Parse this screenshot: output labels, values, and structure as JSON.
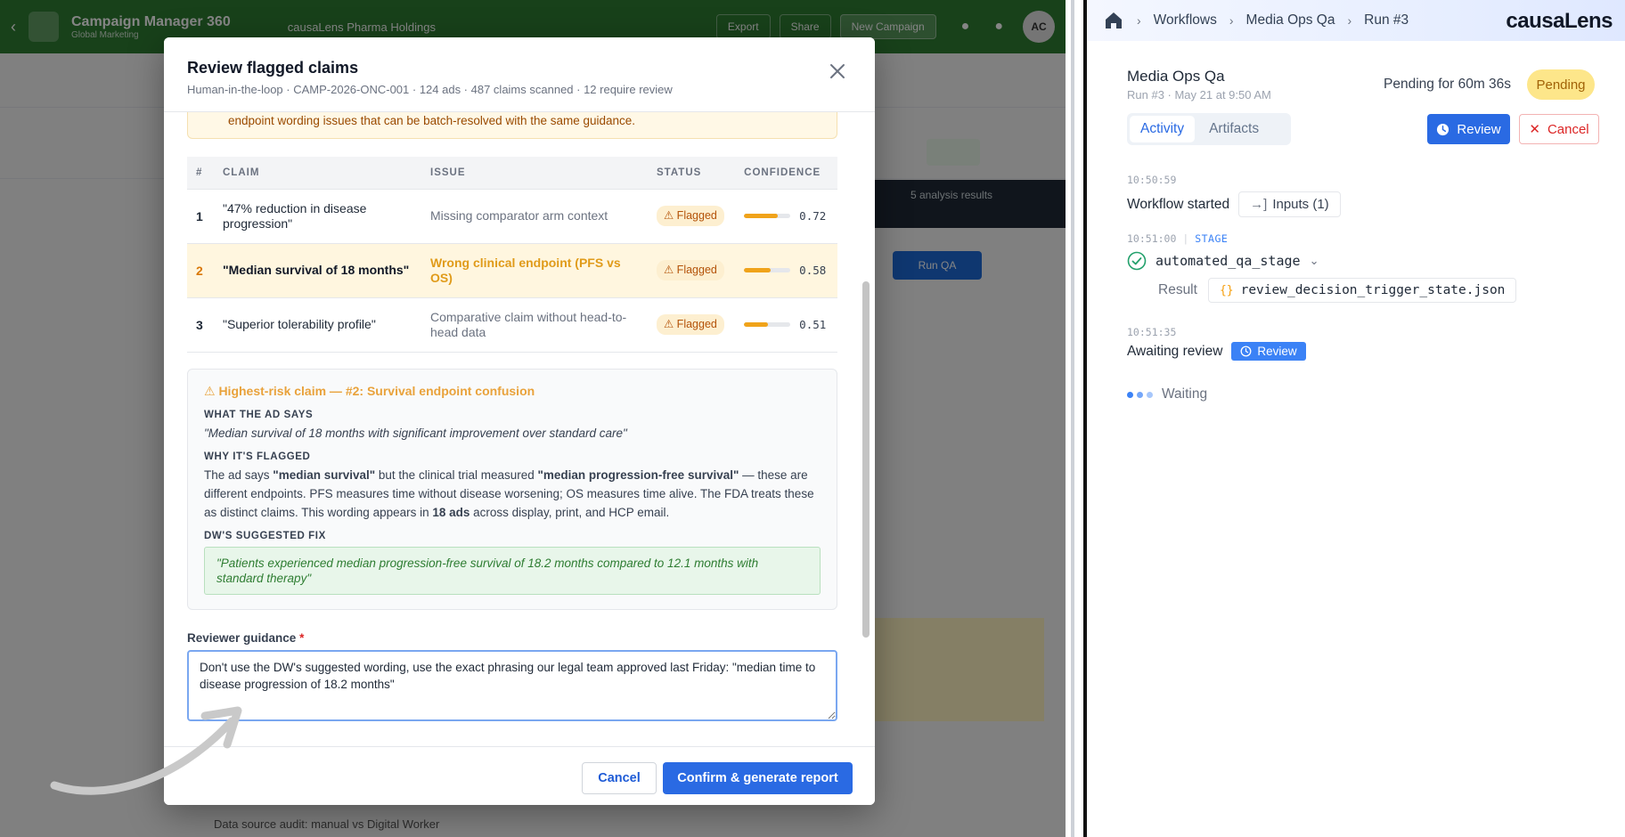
{
  "background_app": {
    "title": "Campaign Manager 360",
    "subtitle": "Global Marketing",
    "org": "causaLens Pharma Holdings",
    "buttons": [
      "Export",
      "Share",
      "New Campaign"
    ],
    "avatar": "AC",
    "dark_bar_text": "5 analysis results",
    "blue_button": "Run QA",
    "footer_text": "Data source audit: manual vs Digital Worker"
  },
  "modal": {
    "title": "Review flagged claims",
    "subtitle": "Human-in-the-loop · CAMP-2026-ONC-001 · 124 ads · 487 claims scanned · 12 require review",
    "warning_text": "endpoint wording issues that can be batch-resolved with the same guidance.",
    "table": {
      "headers": [
        "#",
        "CLAIM",
        "ISSUE",
        "STATUS",
        "CONFIDENCE"
      ],
      "rows": [
        {
          "num": "1",
          "claim": "\"47% reduction in disease progression\"",
          "issue": "Missing comparator arm context",
          "status": "⚠ Flagged",
          "confidence": 0.72,
          "confidence_text": "0.72"
        },
        {
          "num": "2",
          "claim": "\"Median survival of 18 months\"",
          "issue": "Wrong clinical endpoint (PFS vs OS)",
          "status": "⚠ Flagged",
          "confidence": 0.58,
          "confidence_text": "0.58"
        },
        {
          "num": "3",
          "claim": "\"Superior tolerability profile\"",
          "issue": "Comparative claim without head-to-head data",
          "status": "⚠ Flagged",
          "confidence": 0.51,
          "confidence_text": "0.51"
        }
      ]
    },
    "risk": {
      "title": "⚠ Highest-risk claim — #2: Survival endpoint confusion",
      "ad_says_label": "WHAT THE AD SAYS",
      "ad_says_text": "\"Median survival of 18 months with significant improvement over standard care\"",
      "why_label": "WHY IT'S FLAGGED",
      "why_text_1": "The ad says ",
      "why_bold_1": "\"median survival\"",
      "why_text_2": " but the clinical trial measured ",
      "why_bold_2": "\"median progression-free survival\"",
      "why_text_3": " — these are different endpoints. PFS measures time without disease worsening; OS measures time alive. The FDA treats these as distinct claims. This wording appears in ",
      "why_bold_3": "18 ads",
      "why_text_4": " across display, print, and HCP email.",
      "fix_label": "DW'S SUGGESTED FIX",
      "fix_text": "\"Patients experienced median progression-free survival of 18.2 months compared to 12.1 months with standard therapy\""
    },
    "guidance": {
      "label": "Reviewer guidance",
      "required_mark": "*",
      "value": "Don't use the DW's suggested wording, use the exact phrasing our legal team approved last Friday: \"median time to disease progression of 18.2 months\""
    },
    "footer": {
      "cancel_label": "Cancel",
      "confirm_label": "Confirm & generate report"
    }
  },
  "right_panel": {
    "breadcrumbs": [
      "Workflows",
      "Media Ops Qa",
      "Run #3"
    ],
    "brand": "causaLens",
    "title": "Media Ops Qa",
    "run_meta": "Run #3 · May 21 at 9:50 AM",
    "pending_for": "Pending for 60m 36s",
    "pending_badge": "Pending",
    "tabs": [
      "Activity",
      "Artifacts"
    ],
    "active_tab": "Activity",
    "review_button": "Review",
    "cancel_button": "Cancel",
    "activity": {
      "ts1": "10:50:59",
      "started": "Workflow started",
      "inputs_chip": "Inputs (1)",
      "ts2": "10:51:00",
      "stage_tag": "STAGE",
      "stage_name": "automated_qa_stage",
      "result_label": "Result",
      "result_file": "review_decision_trigger_state.json",
      "ts3": "10:51:35",
      "awaiting": "Awaiting review",
      "review_chip": "Review",
      "waiting": "Waiting"
    },
    "colors": {
      "primary": "#2a6ae3",
      "pending_bg": "#fde68a",
      "flag": "#f0a31a"
    }
  }
}
